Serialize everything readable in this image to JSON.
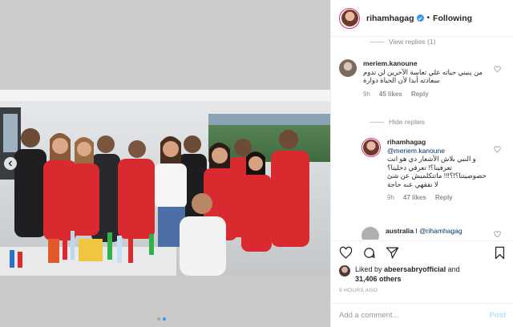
{
  "header": {
    "username": "rihamhagag",
    "separator": "•",
    "follow_label": "Following"
  },
  "comments": {
    "view_replies_1": "View replies (1)",
    "comment1": {
      "username": "meriem.kanoune",
      "text": "من ينبني حياته علي تعاسة الآخرين لن تدوم سعادته أبدا لأن الحياة دوارة",
      "time": "9h",
      "likes": "45 likes",
      "reply_label": "Reply"
    },
    "hide_replies": "Hide replies",
    "reply1": {
      "username": "rihamhagag",
      "mention": "@meriem.kanoune",
      "text": "و النبي بلاش الأشعار دي هو انت تعرفينا؟! تعرفي دخلينا؟ خصوصيتنا؟!؟!!! ماتتكلميش عن شئ لا تفقهي عنه حاجة",
      "time": "9h",
      "likes": "47 likes",
      "reply_label": "Reply"
    },
    "comment2": {
      "username": "australia",
      "text": "I @rihamhagag"
    }
  },
  "likes": {
    "prefix": "Liked by",
    "liker": "abeersabryofficial",
    "joiner": "and",
    "others": "31,406 others"
  },
  "timestamp": "9 HOURS AGO",
  "add_comment": {
    "placeholder": "Add a comment...",
    "post_label": "Post"
  },
  "colors": {
    "accent": "#3897f0",
    "jersey_red": "#d92a2f",
    "post_disabled": "#b2dffc"
  },
  "icons": [
    "verified-badge-icon",
    "chevron-left-icon",
    "heart-icon",
    "comment-icon",
    "share-icon",
    "bookmark-icon"
  ]
}
